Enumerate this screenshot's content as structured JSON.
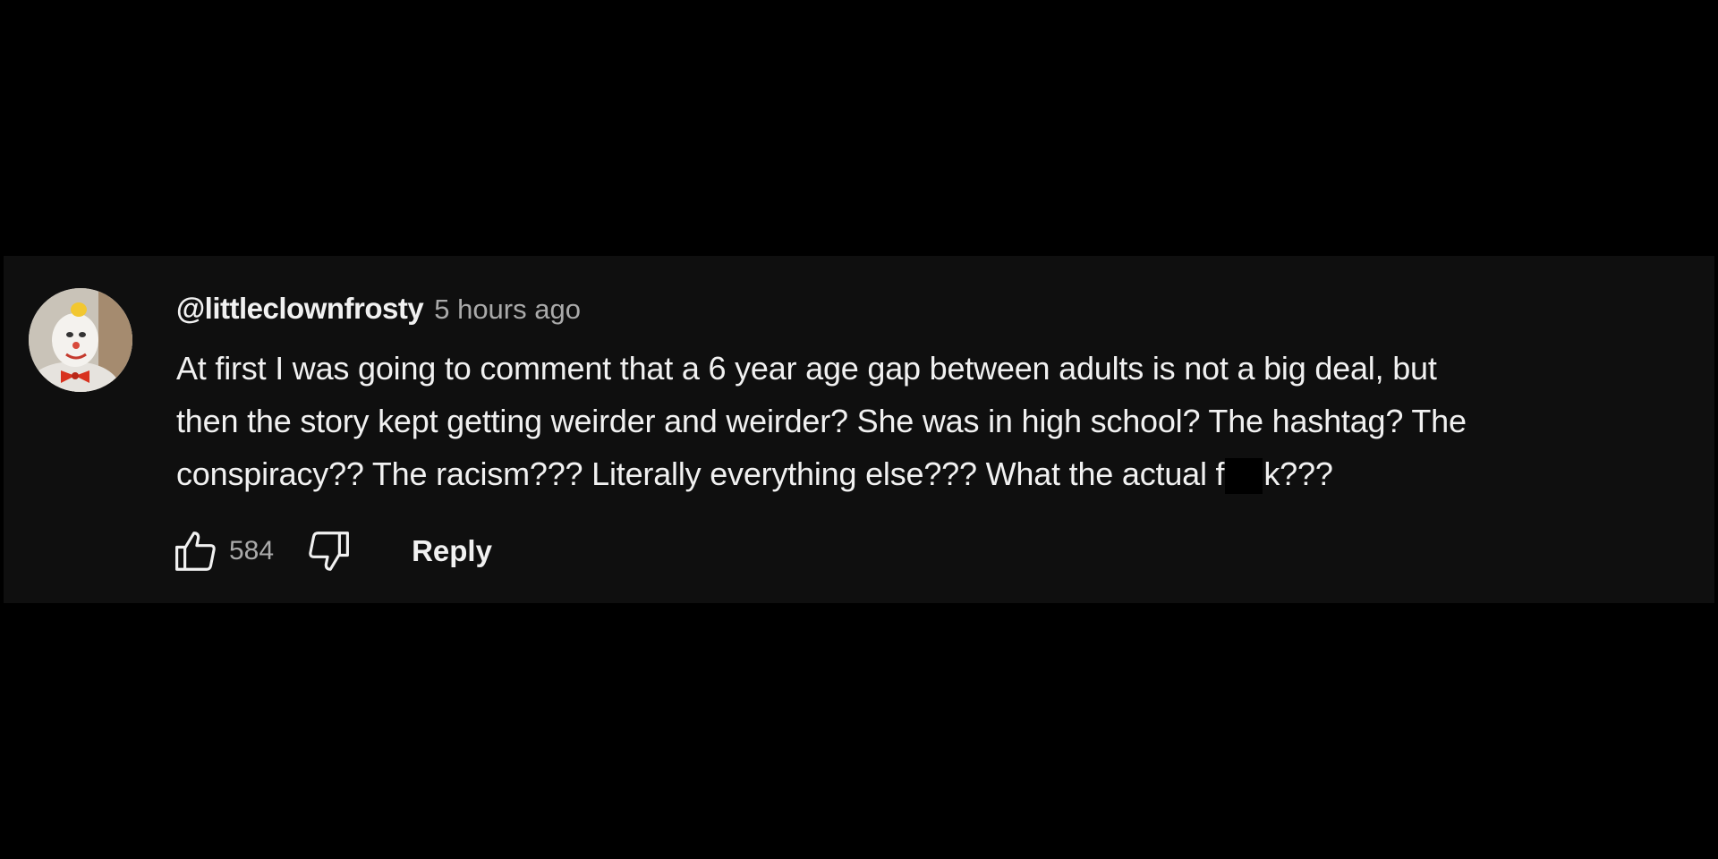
{
  "comment": {
    "author": "@littleclownfrosty",
    "timestamp": "5 hours ago",
    "text_lines": [
      "At first I was going to comment that a 6 year age gap between adults is not a big deal, but",
      "then the story kept getting weirder and weirder? She was in high school? The hashtag? The"
    ],
    "last_line_before": "conspiracy?? The racism??? Literally everything else??? What the actual f",
    "last_line_after": "k???",
    "like_count": "584",
    "reply_label": "Reply"
  },
  "icons": {
    "avatar": "clown-avatar",
    "like": "thumbs-up-icon",
    "dislike": "thumbs-down-icon"
  },
  "colors": {
    "background": "#000000",
    "card": "#0f0f0f",
    "text_primary": "#f1f1f1",
    "text_secondary": "#aaaaaa"
  }
}
